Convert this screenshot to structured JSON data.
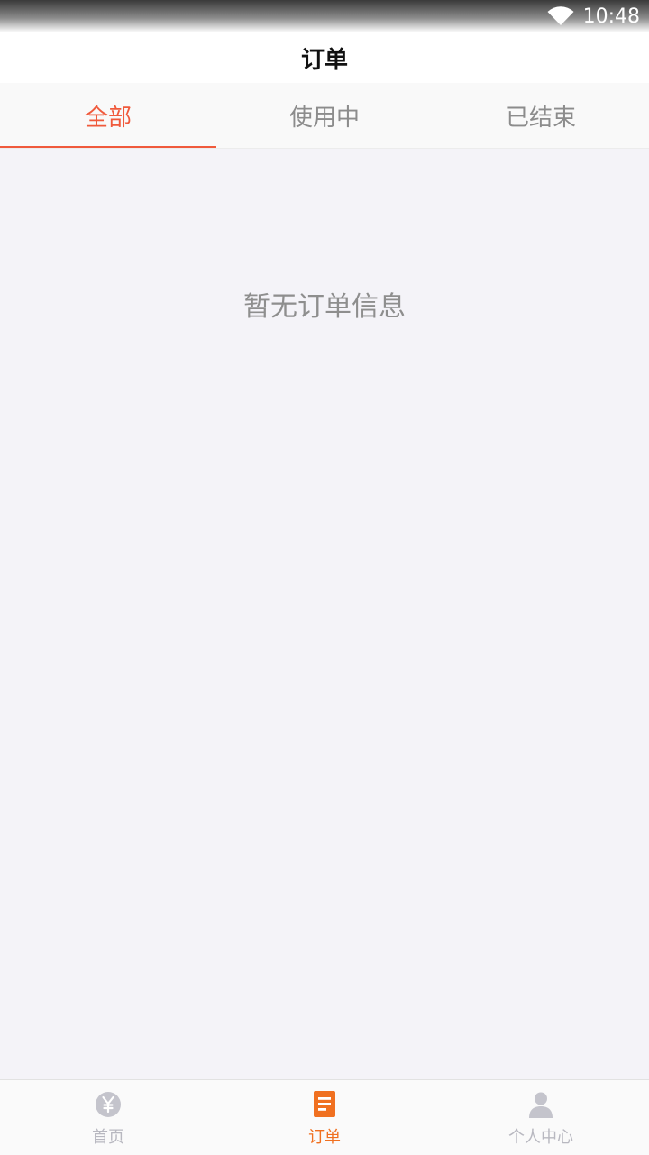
{
  "status_bar": {
    "time": "10:48",
    "icons": [
      "wifi-icon"
    ]
  },
  "header": {
    "title": "订单"
  },
  "tabs": [
    {
      "label": "全部",
      "active": true
    },
    {
      "label": "使用中",
      "active": false
    },
    {
      "label": "已结束",
      "active": false
    }
  ],
  "main": {
    "empty_message": "暂无订单信息"
  },
  "bottom_nav": [
    {
      "label": "首页",
      "icon": "yen-coin-icon",
      "active": false
    },
    {
      "label": "订单",
      "icon": "order-document-icon",
      "active": true
    },
    {
      "label": "个人中心",
      "icon": "person-icon",
      "active": false
    }
  ],
  "colors": {
    "accent_tab": "#f05a3c",
    "accent_nav": "#f07020",
    "inactive": "#b8b8c0",
    "background": "#f4f3f8"
  }
}
